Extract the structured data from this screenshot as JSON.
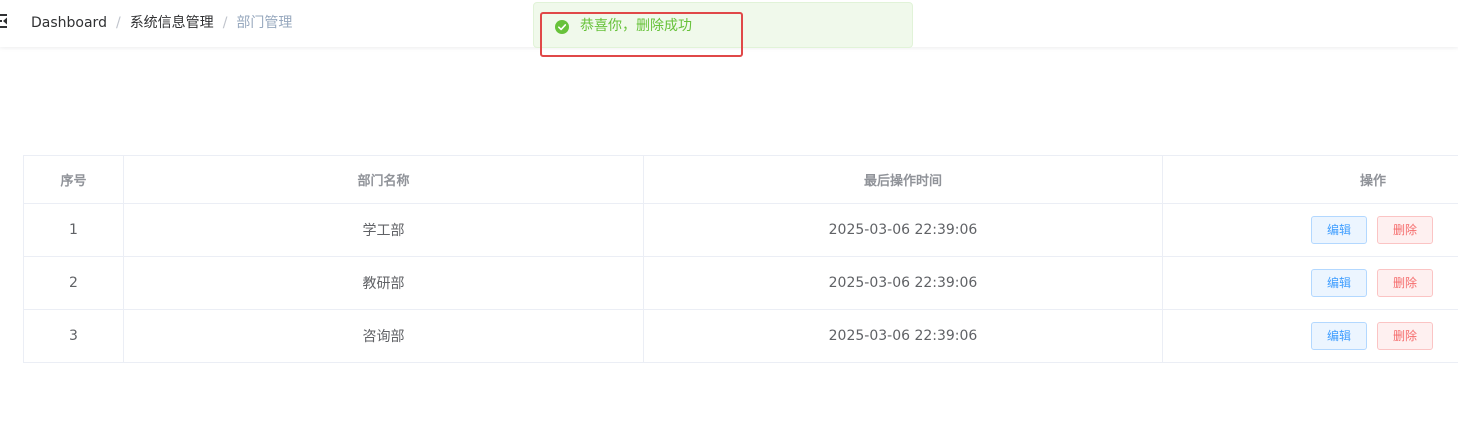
{
  "breadcrumb": {
    "items": [
      "Dashboard",
      "系统信息管理",
      "部门管理"
    ],
    "separator": "/"
  },
  "toast": {
    "type": "success",
    "icon": "check-circle-icon",
    "message": "恭喜你，删除成功",
    "color": "#67c23a"
  },
  "table": {
    "headers": {
      "index": "序号",
      "name": "部门名称",
      "time": "最后操作时间",
      "ops": "操作"
    },
    "rows": [
      {
        "index": "1",
        "name": "学工部",
        "time": "2025-03-06 22:39:06"
      },
      {
        "index": "2",
        "name": "教研部",
        "time": "2025-03-06 22:39:06"
      },
      {
        "index": "3",
        "name": "咨询部",
        "time": "2025-03-06 22:39:06"
      }
    ],
    "edit_label": "编辑",
    "delete_label": "删除"
  },
  "colors": {
    "edit": "#409eff",
    "delete": "#f56c6c",
    "highlight": "#e04848"
  }
}
